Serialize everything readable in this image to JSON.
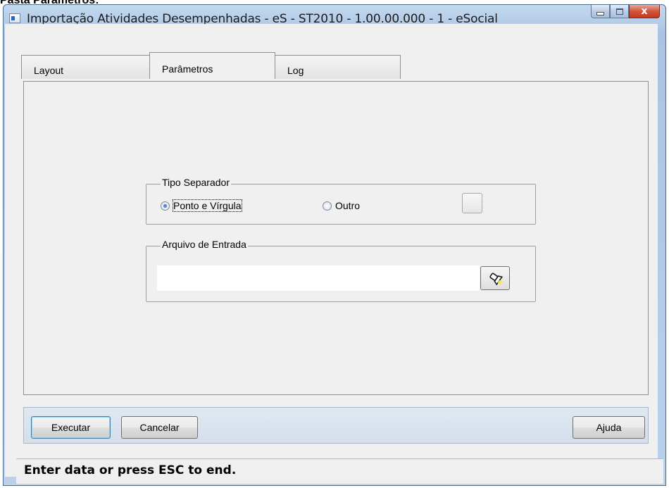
{
  "doc_heading": "Pasta Parâmetros:",
  "window": {
    "title": "Importação Atividades Desempenhadas - eS - ST2010 - 1.00.00.000 - 1 - eSocial",
    "controls": {
      "close_glyph": "x"
    }
  },
  "tabs": [
    {
      "label": "Layout",
      "active": false
    },
    {
      "label": "Parâmetros",
      "active": true
    },
    {
      "label": "Log",
      "active": false
    }
  ],
  "tipo_separador": {
    "legend": "Tipo Separador",
    "options": [
      {
        "label": "Ponto e Vírgula",
        "checked": true
      },
      {
        "label": "Outro",
        "checked": false
      }
    ],
    "outro_value": ""
  },
  "arquivo_entrada": {
    "legend": "Arquivo de Entrada",
    "value": "",
    "browse_icon": "flashlight-search-icon"
  },
  "buttons": {
    "executar": "Executar",
    "cancelar": "Cancelar",
    "ajuda": "Ajuda"
  },
  "status": "Enter data or press ESC to end."
}
